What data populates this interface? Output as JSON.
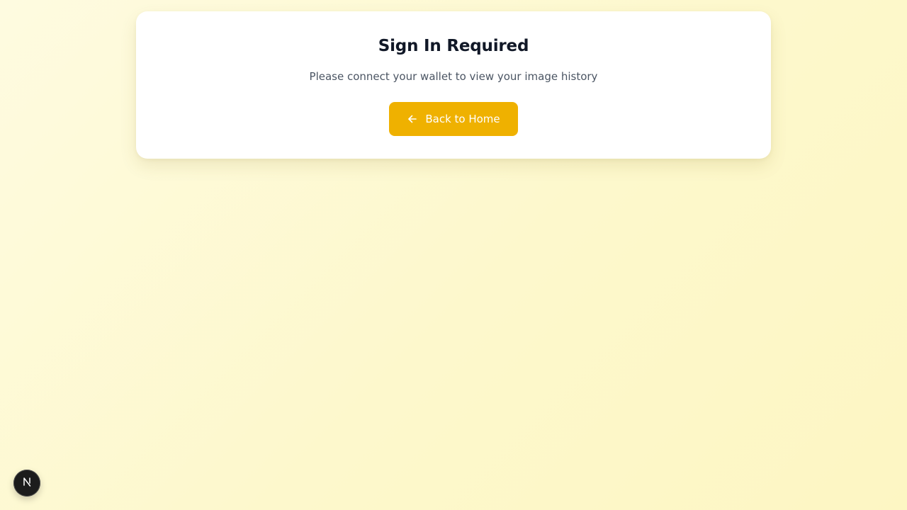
{
  "card": {
    "title": "Sign In Required",
    "message": "Please connect your wallet to view your image history",
    "back_button_label": "Back to Home",
    "back_button_icon": "arrow-left-icon"
  },
  "dev_badge": {
    "icon": "nextjs-logo-icon"
  },
  "colors": {
    "accent": "#efb100",
    "title": "#111827",
    "subtitle": "#4b5563",
    "background": "#fdf8cc"
  }
}
